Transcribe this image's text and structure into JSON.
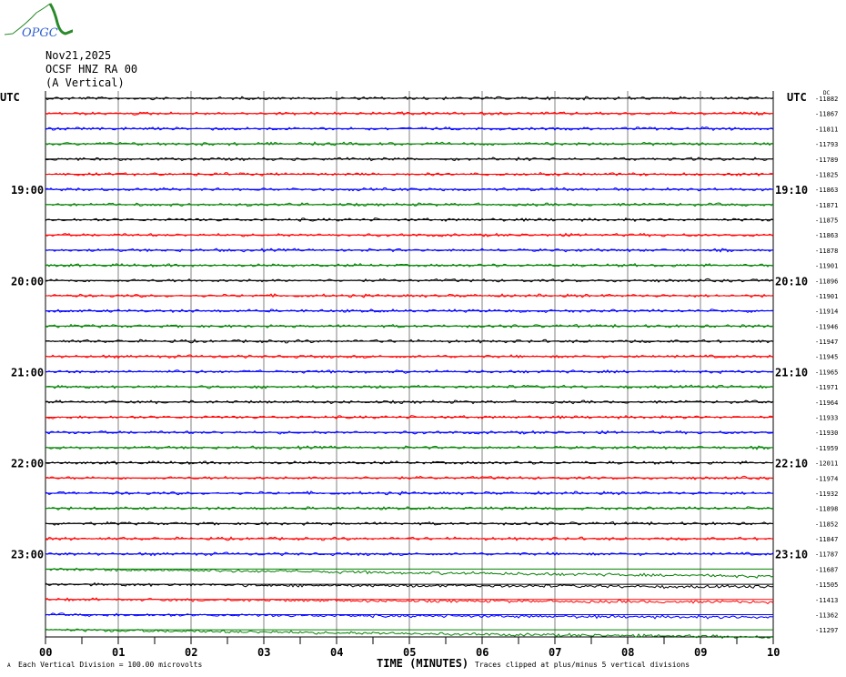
{
  "header": {
    "logo_text": "OPGC",
    "date": "Nov21,2025",
    "station": "OCSF HNZ RA 00",
    "component": "(A Vertical)"
  },
  "colors": {
    "trace_cycle": [
      "#000000",
      "#ff0000",
      "#0000ff",
      "#008000"
    ],
    "grid": "#808080"
  },
  "chart_data": {
    "type": "line",
    "subtype": "helicorder",
    "xlabel": "TIME (MINUTES)",
    "x_ticks": [
      "00",
      "01",
      "02",
      "03",
      "04",
      "05",
      "06",
      "07",
      "08",
      "09",
      "10"
    ],
    "xlim": [
      0,
      10
    ],
    "left_axis_title": "UTC",
    "right_axis_title": "UTC",
    "dc_title": "DC",
    "left_labels": [
      {
        "row": 6,
        "text": "19:00"
      },
      {
        "row": 12,
        "text": "20:00"
      },
      {
        "row": 18,
        "text": "21:00"
      },
      {
        "row": 24,
        "text": "22:00"
      },
      {
        "row": 30,
        "text": "23:00"
      }
    ],
    "right_labels": [
      {
        "row": 6,
        "text": "19:10"
      },
      {
        "row": 12,
        "text": "20:10"
      },
      {
        "row": 18,
        "text": "21:10"
      },
      {
        "row": 24,
        "text": "22:10"
      },
      {
        "row": 30,
        "text": "23:10"
      }
    ],
    "dc_offsets": [
      -11882,
      -11867,
      -11811,
      -11793,
      -11789,
      -11825,
      -11863,
      -11871,
      -11875,
      -11863,
      -11878,
      -11901,
      -11896,
      -11901,
      -11914,
      -11946,
      -11947,
      -11945,
      -11965,
      -11971,
      -11964,
      -11933,
      -11930,
      -11959,
      -12011,
      -11974,
      -11932,
      -11898,
      -11852,
      -11847,
      -11787,
      -11687,
      -11505,
      -11413,
      -11362,
      -11297
    ],
    "scale_note": "Each Vertical Division =  100.00 microvolts",
    "clip_note": "Traces clipped at plus/minus 5 vertical divisions"
  }
}
